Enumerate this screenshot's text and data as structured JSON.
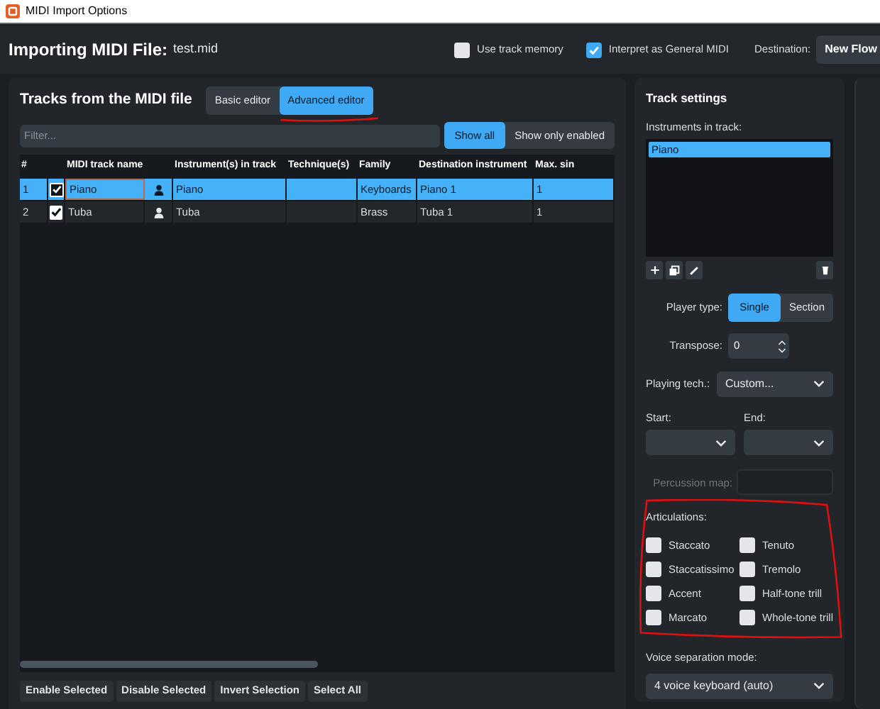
{
  "window": {
    "title": "MIDI Import Options"
  },
  "header": {
    "label": "Importing MIDI File:",
    "file": "test.mid",
    "options": [
      {
        "label": "Use track memory",
        "checked": false
      },
      {
        "label": "Interpret as General MIDI",
        "checked": true
      }
    ],
    "destination_label": "Destination:",
    "destination_value": "New Flow"
  },
  "tracks_panel": {
    "title": "Tracks from the MIDI file",
    "editor_tabs": [
      {
        "label": "Basic editor",
        "selected": false
      },
      {
        "label": "Advanced editor",
        "selected": true
      }
    ],
    "filter": {
      "placeholder": "Filter..."
    },
    "view_toggle": [
      {
        "label": "Show all",
        "selected": true
      },
      {
        "label": "Show only enabled",
        "selected": false
      }
    ],
    "table": {
      "columns": [
        "#",
        "MIDI track name",
        "Instrument(s) in track",
        "Technique(s)",
        "Family",
        "Destination instrument",
        "Max. sin"
      ],
      "rows": [
        {
          "number": "1",
          "enabled": true,
          "selected": true,
          "name": "Piano",
          "instruments": "Piano",
          "family": "Keyboards",
          "destination": "Piano 1",
          "max": "1"
        },
        {
          "number": "2",
          "enabled": true,
          "selected": false,
          "name": "Tuba",
          "instruments": "Tuba",
          "family": "Brass",
          "destination": "Tuba 1",
          "max": "1"
        }
      ]
    },
    "footer_buttons": [
      "Enable Selected",
      "Disable Selected",
      "Invert Selection",
      "Select All"
    ]
  },
  "track_settings": {
    "title": "Track settings",
    "instruments_label": "Instruments in track:",
    "instruments": [
      {
        "name": "Piano",
        "selected": true
      }
    ],
    "player_type_label": "Player type:",
    "player_types": [
      {
        "label": "Single",
        "selected": true
      },
      {
        "label": "Section",
        "selected": false
      }
    ],
    "transpose_label": "Transpose:",
    "transpose_value": "0",
    "playing_tech_label": "Playing tech.:",
    "playing_tech_value": "Custom...",
    "start_label": "Start:",
    "end_label": "End:",
    "percussion_map": {
      "label": "Percussion map:",
      "disabled": true
    },
    "articulations_label": "Articulations:",
    "articulations": [
      {
        "label": "Staccato",
        "checked": false
      },
      {
        "label": "Tenuto",
        "checked": false
      },
      {
        "label": "Staccatissimo",
        "checked": false
      },
      {
        "label": "Tremolo",
        "checked": false
      },
      {
        "label": "Accent",
        "checked": false
      },
      {
        "label": "Half-tone trill",
        "checked": false
      },
      {
        "label": "Marcato",
        "checked": false
      },
      {
        "label": "Whole-tone trill",
        "checked": false
      }
    ],
    "voice_separation_label": "Voice separation mode:",
    "voice_separation_value": "4 voice keyboard (auto)"
  },
  "annotations": [
    {
      "kind": "underline"
    },
    {
      "kind": "ellipse"
    }
  ]
}
